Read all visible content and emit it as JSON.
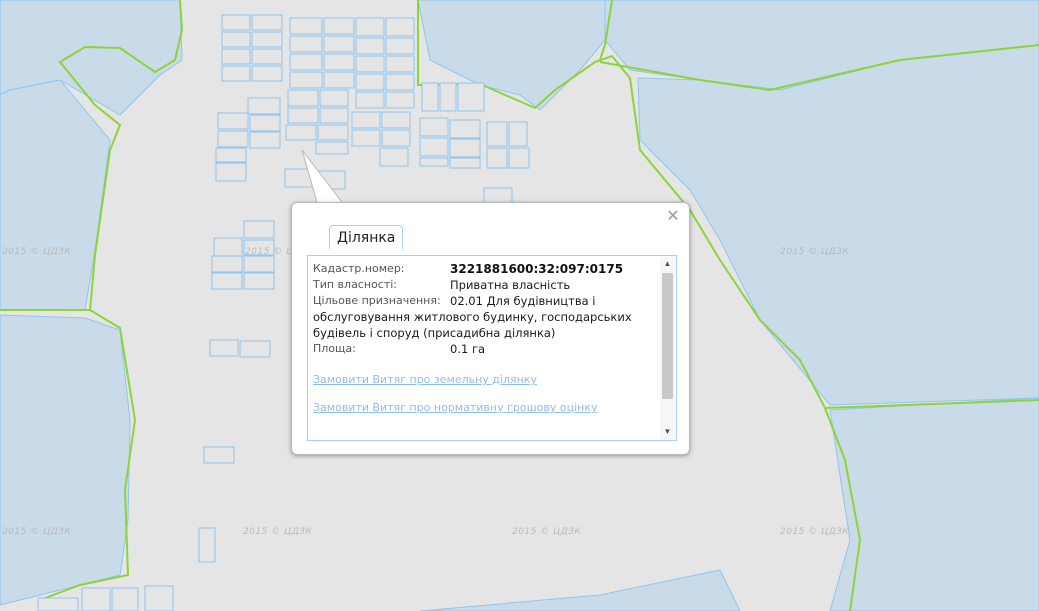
{
  "map": {
    "watermark": "2015 © ЦДЗК",
    "colors": {
      "background": "#e5e5e5",
      "water": "#c9dbe8",
      "parcel_stroke": "#8fc5ee",
      "boundary": "#8dd33a"
    }
  },
  "popup": {
    "tab_label": "Ділянка",
    "close_icon": "close-icon",
    "fields": {
      "cadastral_label": "Кадастр.номер:",
      "cadastral_value": "3221881600:32:097:0175",
      "ownership_label": "Тип власності:",
      "ownership_value": "Приватна власність",
      "purpose_label": "Цільове призначення:",
      "purpose_line1": "02.01 Для будівництва і",
      "purpose_line2": "обслуговування житлового будинку, господарських",
      "purpose_line3": "будівель і споруд (присадибна ділянка)",
      "area_label": "Площа:",
      "area_value": "0.1 га"
    },
    "links": {
      "order_extract": "Замовити Витяг про земельну ділянку",
      "order_valuation": "Замовити Витяг про нормативну грошову оцінку"
    }
  }
}
